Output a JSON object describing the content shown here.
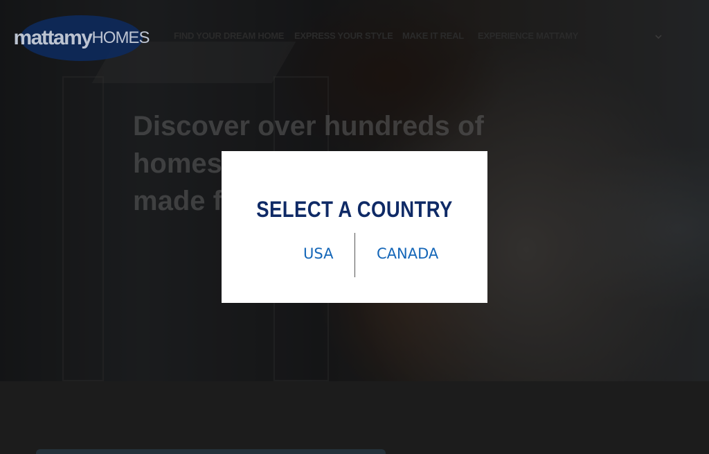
{
  "header": {
    "logo": {
      "brand_part1": "mattamy",
      "brand_part2": "HOMES"
    },
    "nav": {
      "items": [
        "FIND YOUR DREAM HOME",
        "EXPRESS YOUR STYLE",
        "MAKE IT REAL",
        "EXPERIENCE MATTAMY"
      ]
    },
    "menu_icon": "chevron-down-icon"
  },
  "hero": {
    "headline_line1": "Discover over hundreds of homes",
    "headline_line2": "made for you"
  },
  "modal": {
    "title": "SELECT A COUNTRY",
    "options": [
      "USA",
      "CANADA"
    ]
  },
  "colors": {
    "modal_title": "#0f2a66",
    "option_link": "#1466b8",
    "logo_bg": "#0e2a5c"
  }
}
